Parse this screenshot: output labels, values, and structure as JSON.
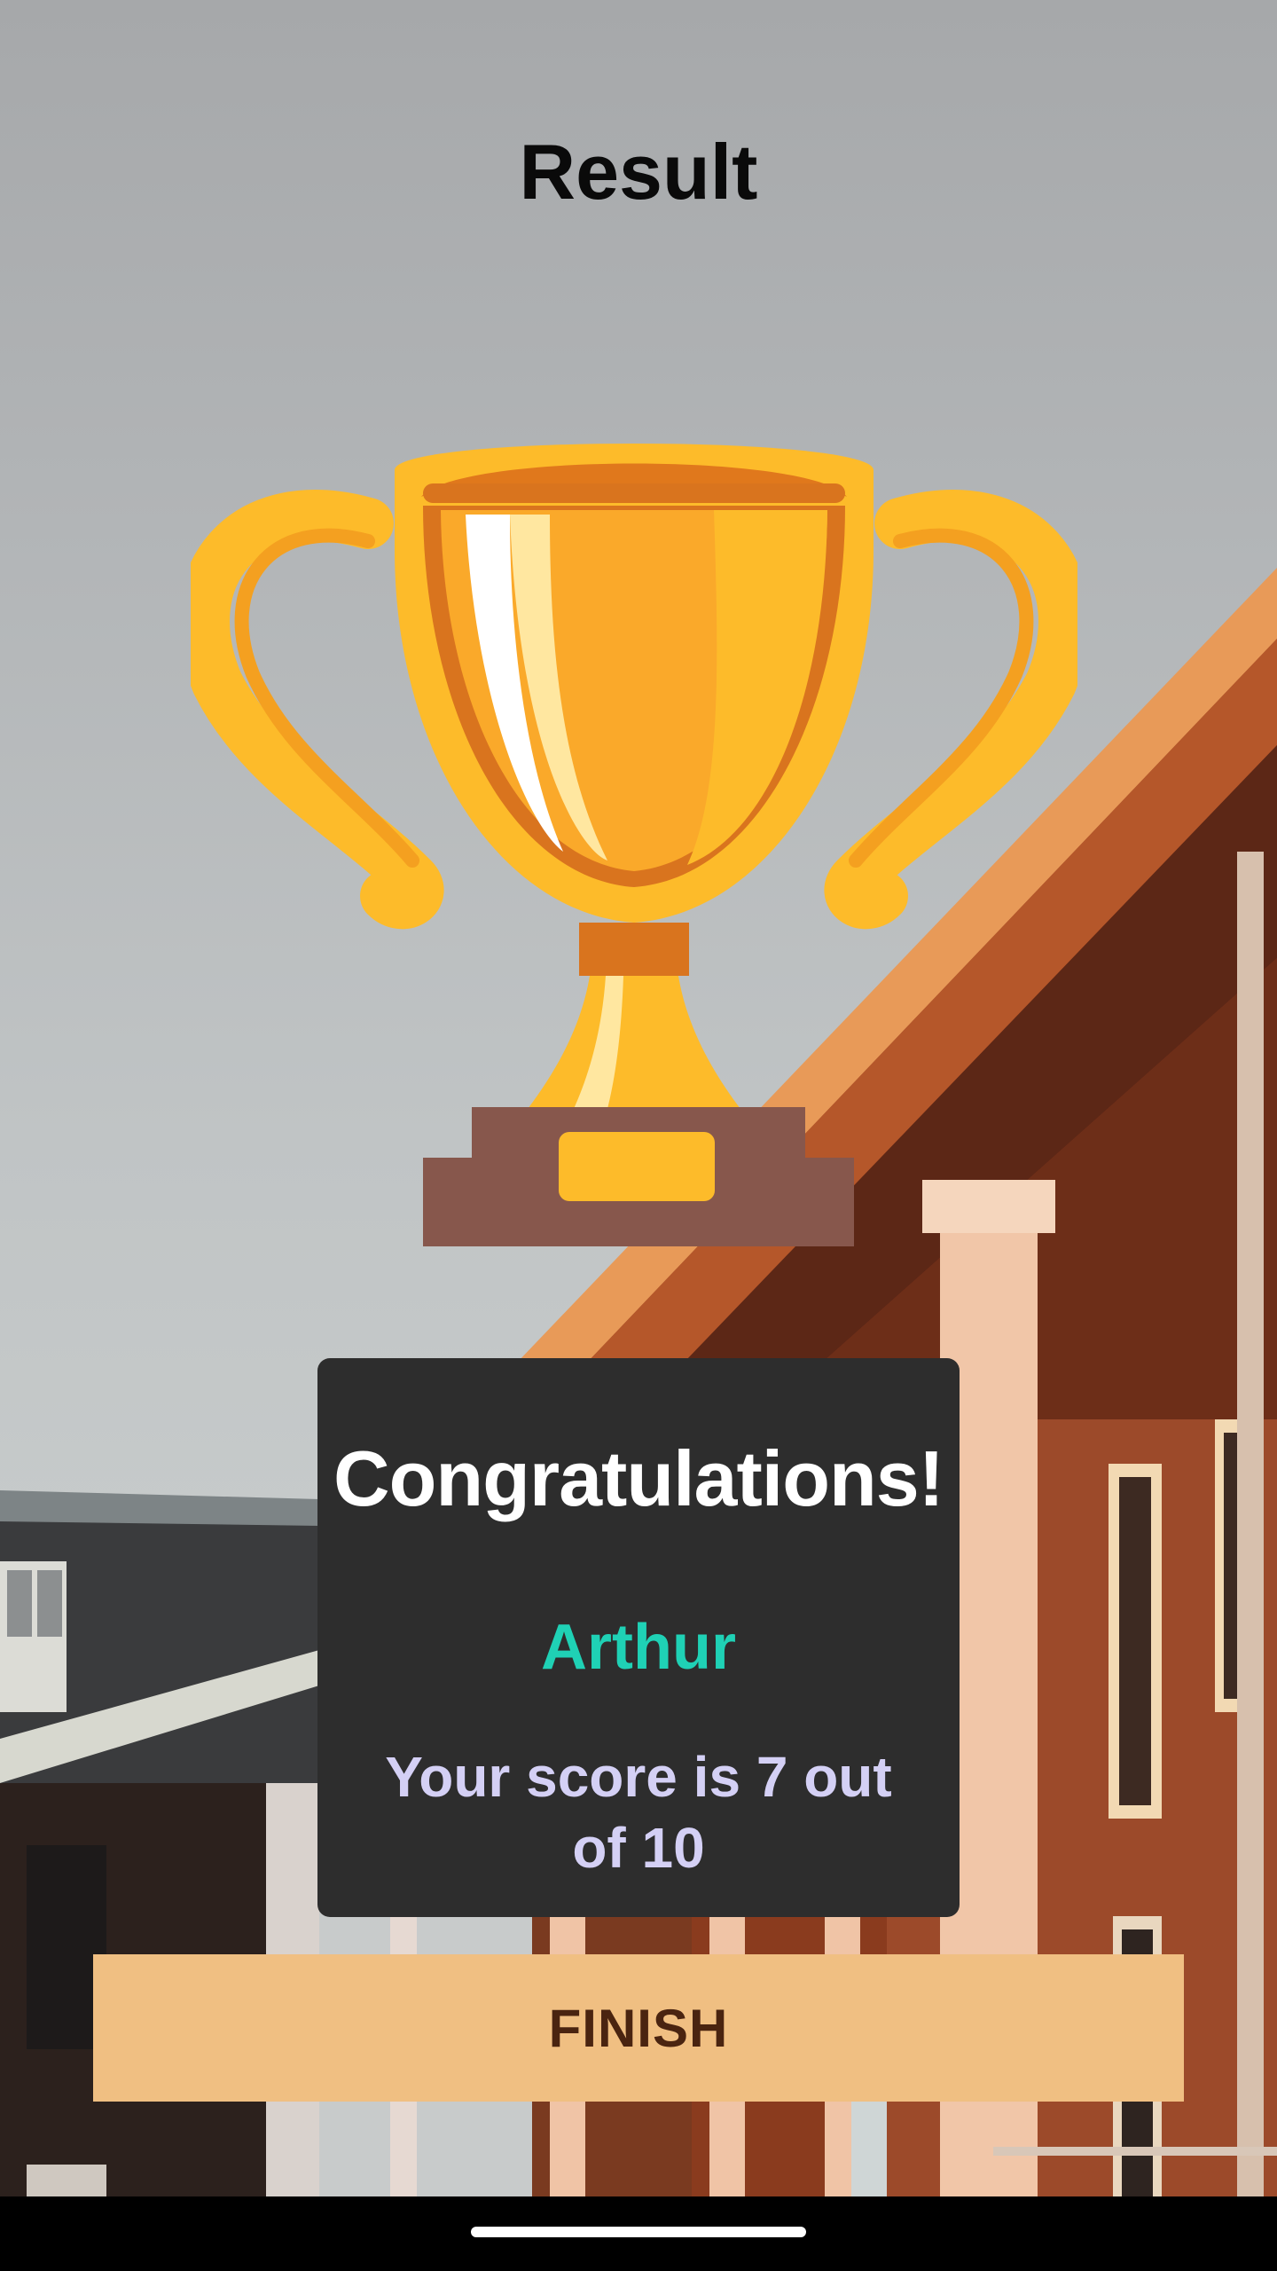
{
  "screen": {
    "title": "Result"
  },
  "result_card": {
    "heading": "Congratulations!",
    "player_name": "Arthur",
    "score_text": "Your score is 7 out of 10"
  },
  "finish_button": {
    "label": "FINISH"
  },
  "icons": {
    "trophy": "trophy-icon",
    "home_indicator": "home-indicator"
  },
  "colors": {
    "title_text": "#0a0a0a",
    "card_background": "#2d2d2d",
    "player_name": "#1fd1b5",
    "score_text": "#d4d0f5",
    "button_background": "#f0bf82",
    "button_text": "#4a2410"
  }
}
